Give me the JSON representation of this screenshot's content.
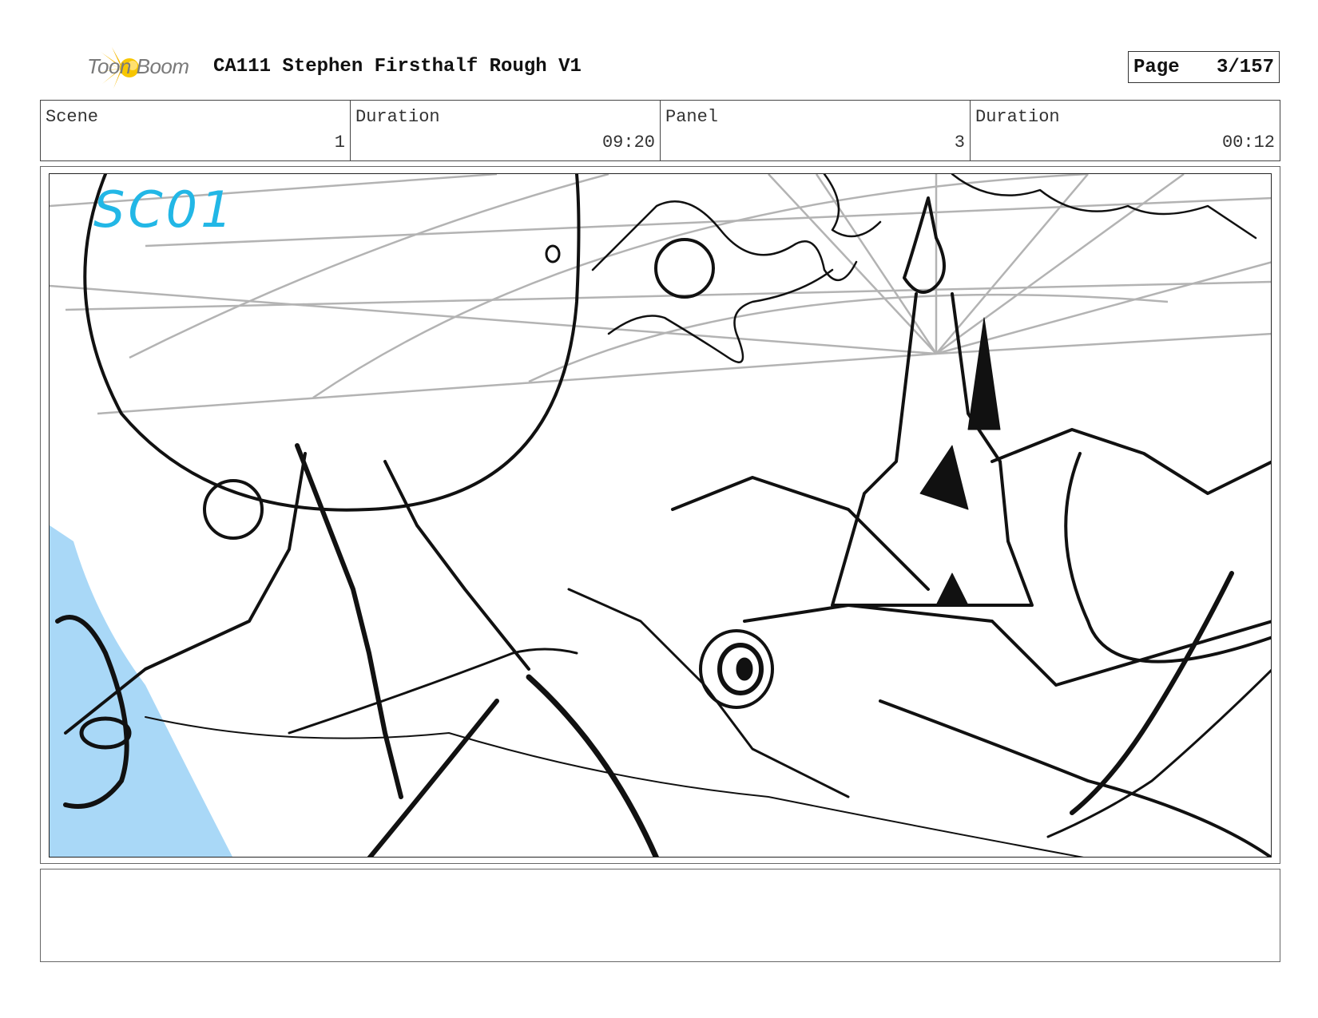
{
  "header": {
    "logo_text": "Toon Boom",
    "title": "CA111 Stephen Firsthalf Rough V1",
    "page_label": "Page",
    "page_value": "3/157"
  },
  "info": {
    "scene_label": "Scene",
    "scene_value": "1",
    "scene_duration_label": "Duration",
    "scene_duration_value": "09:20",
    "panel_label": "Panel",
    "panel_value": "3",
    "panel_duration_label": "Duration",
    "panel_duration_value": "00:12"
  },
  "panel": {
    "scene_tag": "SC01",
    "colors": {
      "annotation": "#22b7e6",
      "fill_blue": "#a9d8f7",
      "ink": "#111111",
      "guide": "#b3b3b3"
    }
  },
  "notes": {
    "text": ""
  }
}
